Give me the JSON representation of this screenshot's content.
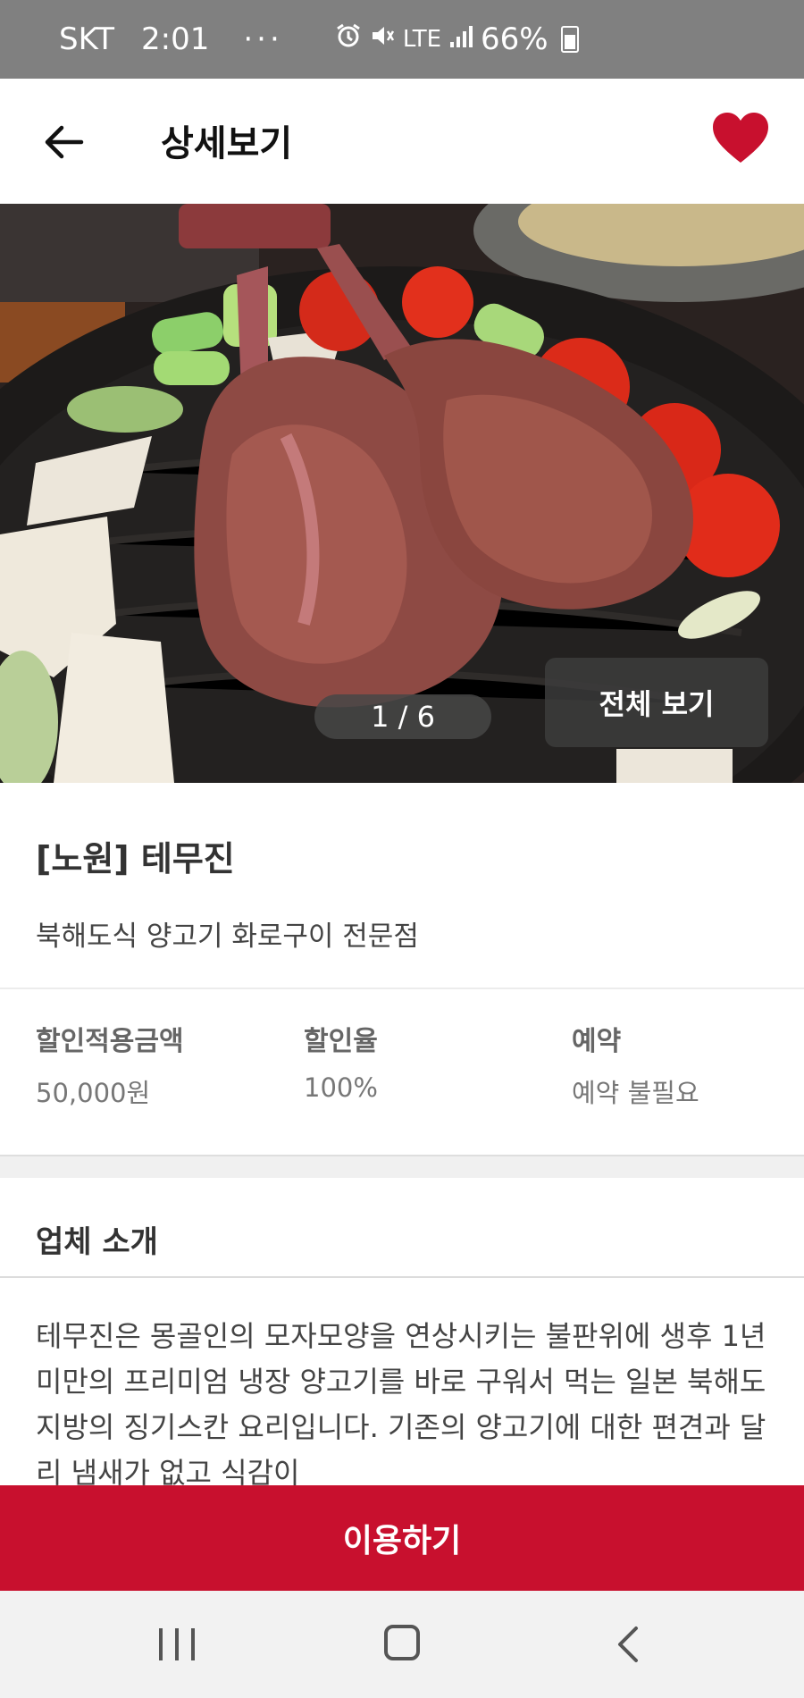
{
  "status_bar": {
    "carrier": "SKT",
    "time": "2:01",
    "more": "···",
    "network": "LTE",
    "battery": "66%"
  },
  "header": {
    "title": "상세보기"
  },
  "gallery": {
    "page_indicator": "1 / 6",
    "view_all_label": "전체 보기"
  },
  "store": {
    "name": "[노원] 테무진",
    "description": "북해도식 양고기 화로구이 전문점"
  },
  "stats": [
    {
      "label": "할인적용금액",
      "value": "50,000원"
    },
    {
      "label": "할인율",
      "value": "100%"
    },
    {
      "label": "예약",
      "value": "예약 불필요"
    }
  ],
  "intro": {
    "title": "업체 소개",
    "text": "테무진은 몽골인의 모자모양을 연상시키는 불판위에 생후 1년 미만의 프리미엄 냉장 양고기를 바로 구워서 먹는 일본 북해도 지방의 징기스칸 요리입니다. 기존의 양고기에 대한 편견과 달리 냄새가 없고 식감이"
  },
  "cta": {
    "label": "이용하기"
  },
  "colors": {
    "accent": "#c8102e",
    "heart": "#c8102e"
  },
  "icons": {
    "back": "arrow-left-icon",
    "favorite": "heart-icon",
    "nav_recent": "recent-apps-icon",
    "nav_home": "home-icon",
    "nav_back": "chevron-left-icon"
  }
}
